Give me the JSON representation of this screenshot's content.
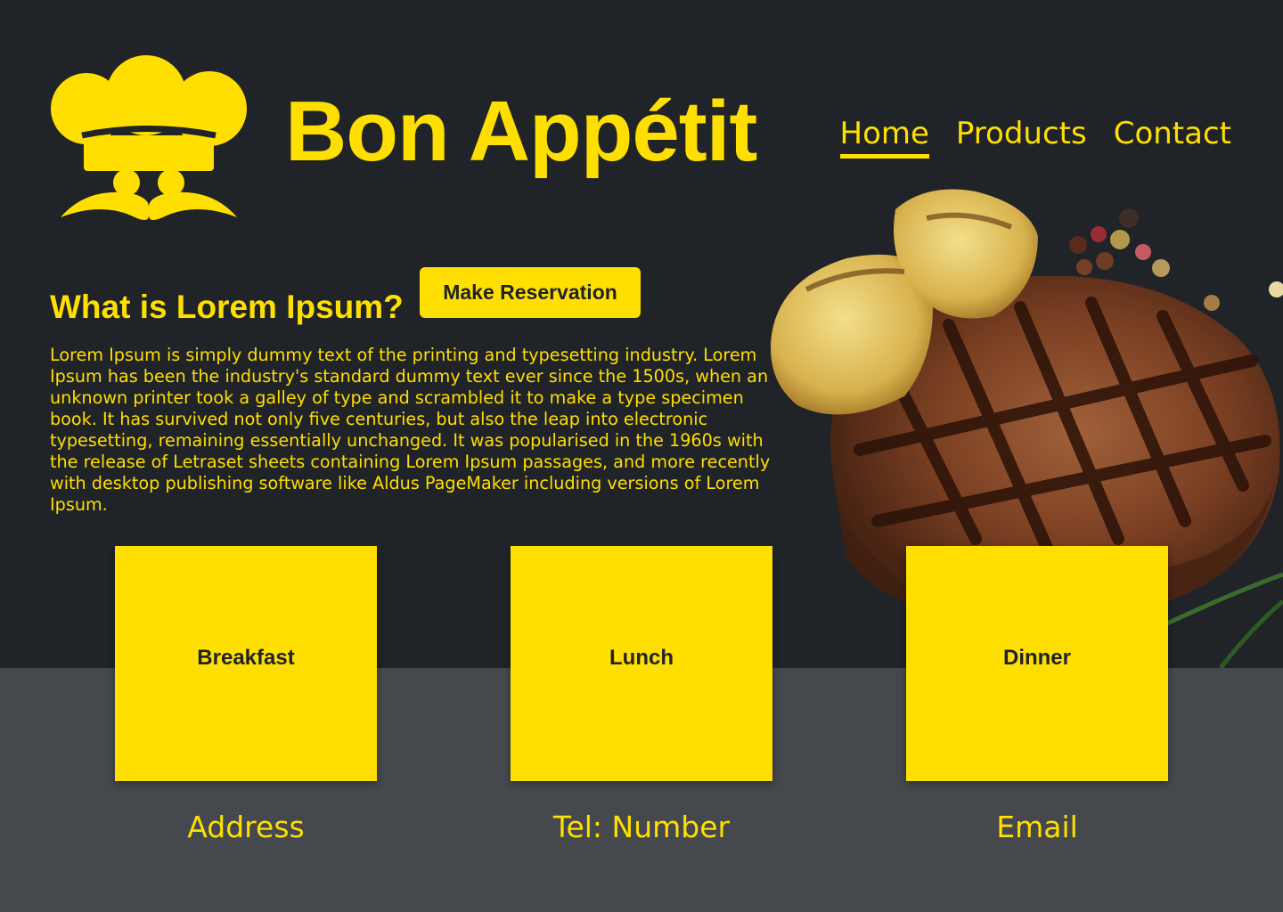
{
  "brand": {
    "name": "Bon Appétit",
    "logo_icon": "chef-hat-mustache-icon"
  },
  "nav": {
    "items": [
      {
        "label": "Home",
        "active": true
      },
      {
        "label": "Products",
        "active": false
      },
      {
        "label": "Contact",
        "active": false
      }
    ]
  },
  "hero": {
    "image": "grilled-steak-potatoes-peppercorns"
  },
  "intro": {
    "title": "What is Lorem Ipsum?",
    "cta_label": "Make Reservation",
    "body": "Lorem Ipsum is simply dummy text of the printing and typesetting industry. Lorem Ipsum has been the industry's standard dummy text ever since the 1500s, when an unknown printer took a galley of type and scrambled it to make a type specimen book. It has survived not only five centuries, but also the leap into electronic typesetting, remaining essentially unchanged. It was popularised in the 1960s with the release of Letraset sheets containing Lorem Ipsum passages, and more recently with desktop publishing software like Aldus PageMaker including versions of Lorem Ipsum."
  },
  "meals": [
    {
      "label": "Breakfast"
    },
    {
      "label": "Lunch"
    },
    {
      "label": "Dinner"
    }
  ],
  "contact": {
    "address": "Address",
    "tel": "Tel: Number",
    "email": "Email"
  },
  "colors": {
    "accent": "#ffdf00",
    "dark_bg": "#202327",
    "footer_bg": "#45484d"
  }
}
